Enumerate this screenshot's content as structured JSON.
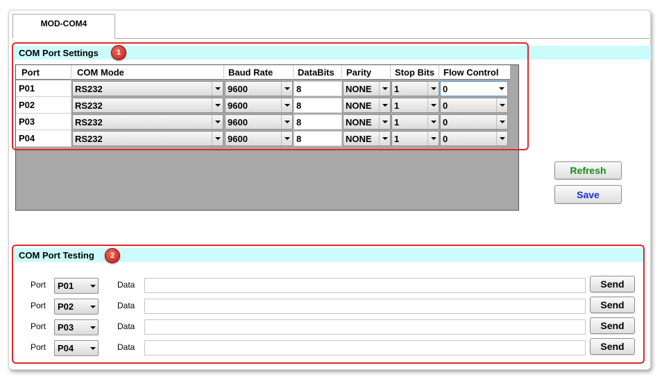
{
  "tab": {
    "label": "MOD-COM4"
  },
  "settings": {
    "title": "COM Port Settings",
    "marker": "1",
    "columns": [
      "Port",
      "COM Mode",
      "Baud Rate",
      "DataBits",
      "Parity",
      "Stop Bits",
      "Flow Control"
    ],
    "rows": [
      {
        "port": "P01",
        "mode": "RS232",
        "baud": "9600",
        "databits": "8",
        "parity": "NONE",
        "stopbits": "1",
        "flow": "0"
      },
      {
        "port": "P02",
        "mode": "RS232",
        "baud": "9600",
        "databits": "8",
        "parity": "NONE",
        "stopbits": "1",
        "flow": "0"
      },
      {
        "port": "P03",
        "mode": "RS232",
        "baud": "9600",
        "databits": "8",
        "parity": "NONE",
        "stopbits": "1",
        "flow": "0"
      },
      {
        "port": "P04",
        "mode": "RS232",
        "baud": "9600",
        "databits": "8",
        "parity": "NONE",
        "stopbits": "1",
        "flow": "0"
      }
    ]
  },
  "actions": {
    "refresh": "Refresh",
    "save": "Save"
  },
  "testing": {
    "title": "COM Port Testing",
    "marker": "2",
    "port_label": "Port",
    "data_label": "Data",
    "send_label": "Send",
    "rows": [
      {
        "port": "P01",
        "data": ""
      },
      {
        "port": "P02",
        "data": ""
      },
      {
        "port": "P03",
        "data": ""
      },
      {
        "port": "P04",
        "data": ""
      }
    ]
  },
  "colors": {
    "section_header_bg": "#ccfbfb",
    "highlight_red": "#e0262b",
    "refresh_text": "#1a8a1a",
    "save_text": "#1a2fd6",
    "grid_bg": "#a8a8a8"
  },
  "icons": {
    "dropdown": "chevron-down-icon"
  }
}
